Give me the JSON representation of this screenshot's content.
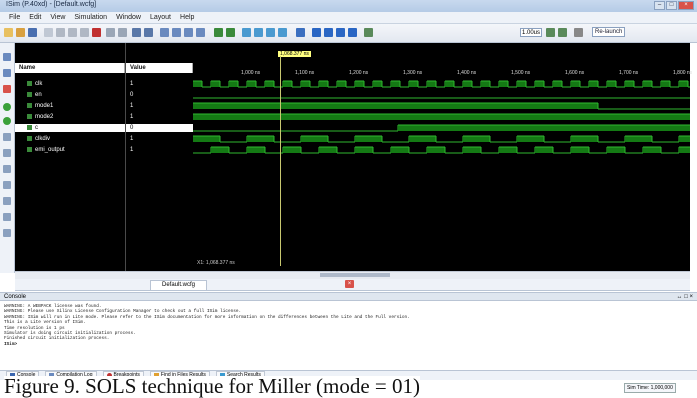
{
  "window": {
    "title": "ISim (P.40xd) - [Default.wcfg]",
    "controls": [
      "–",
      "□",
      "×"
    ]
  },
  "menu": [
    "File",
    "Edit",
    "View",
    "Simulation",
    "Window",
    "Layout",
    "Help"
  ],
  "toolbar": {
    "run_time": "1.00us",
    "relaunch_label": "Re-launch"
  },
  "panel": {
    "name_header": "Name",
    "value_header": "Value",
    "cursor_label": "1,068.377 ns",
    "timeline": [
      "1,000 ns",
      "1,100 ns",
      "1,200 ns",
      "1,300 ns",
      "1,400 ns",
      "1,500 ns",
      "1,600 ns",
      "1,700 ns",
      "1,800 ns"
    ],
    "x_readout": "X1: 1,068.377 ns",
    "signals": [
      {
        "name": "clk",
        "value": "1"
      },
      {
        "name": "en",
        "value": "0"
      },
      {
        "name": "mode1",
        "value": "1"
      },
      {
        "name": "mode2",
        "value": "1"
      },
      {
        "name": "c",
        "value": "0"
      },
      {
        "name": "clkdiv",
        "value": "1"
      },
      {
        "name": "emi_output",
        "value": "1"
      }
    ]
  },
  "doc_tab": "Default.wcfg",
  "console": {
    "title": "Console",
    "lines": [
      "WARNING: A WEBPACK license was found.",
      "WARNING: Please use Xilinx License Configuration Manager to check out a full ISim license.",
      "WARNING: ISim will run in Lite mode. Please refer to the ISim documentation for more information on the differences between the Lite and the Full version.",
      "This is a Lite version of ISim.",
      "Time resolution is 1 ps",
      "Simulator is doing circuit initialization process.",
      "Finished circuit initialization process.",
      "ISim>"
    ]
  },
  "bottom_tabs": [
    "Console",
    "Compilation Log",
    "Breakpoints",
    "Find in Files Results",
    "Search Results"
  ],
  "caption": "Figure 9. SOLS technique for Miller (mode = 01)",
  "status": {
    "sim_time": "Sim Time: 1,000,000"
  },
  "colors": {
    "wave": "#2fb82f",
    "wave_fill": "#147a14",
    "cursor": "#c8c870"
  }
}
